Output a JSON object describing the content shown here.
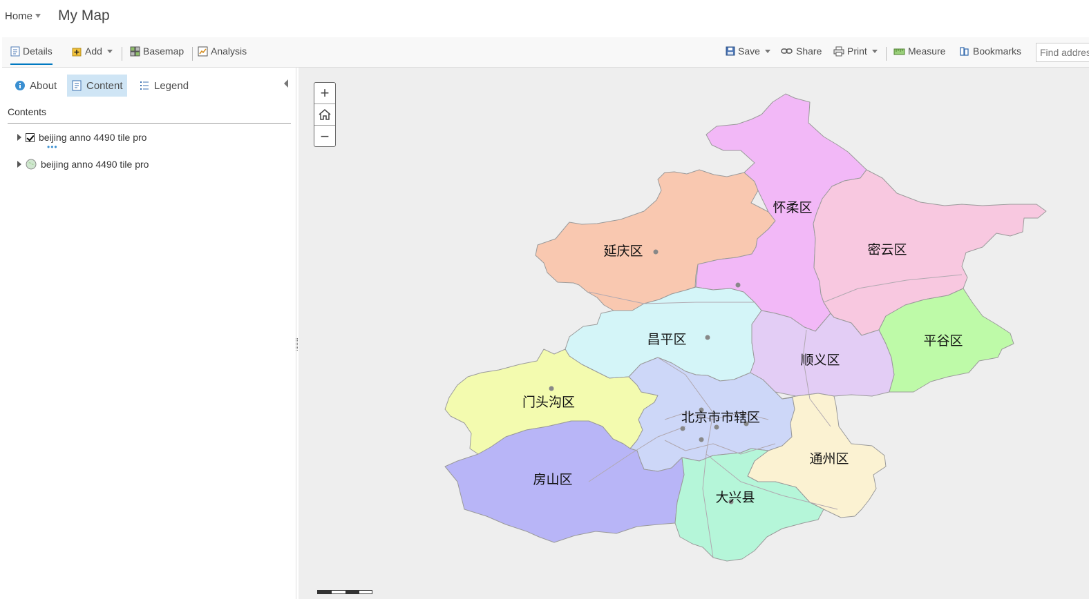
{
  "header": {
    "home_label": "Home",
    "map_title": "My Map"
  },
  "toolbar": {
    "details_label": "Details",
    "add_label": "Add",
    "basemap_label": "Basemap",
    "analysis_label": "Analysis",
    "save_label": "Save",
    "share_label": "Share",
    "print_label": "Print",
    "measure_label": "Measure",
    "bookmarks_label": "Bookmarks",
    "find_placeholder": "Find address or place"
  },
  "panel": {
    "tabs": {
      "about": "About",
      "content": "Content",
      "legend": "Legend"
    },
    "active_tab": "Content",
    "contents_heading": "Contents",
    "layers": [
      {
        "name": "beijing anno 4490 tile pro",
        "checked": true
      },
      {
        "name": "beijing anno 4490 tile pro",
        "checked": false
      }
    ]
  },
  "map": {
    "zoom": {
      "in": "+",
      "out": "−"
    },
    "districts": [
      {
        "name": "延庆区",
        "color": "#f9c8b0"
      },
      {
        "name": "怀柔区",
        "color": "#f2b8f7"
      },
      {
        "name": "密云区",
        "color": "#f8c8e0"
      },
      {
        "name": "昌平区",
        "color": "#d4f5f8"
      },
      {
        "name": "顺义区",
        "color": "#e3cdf5"
      },
      {
        "name": "平谷区",
        "color": "#befaa8"
      },
      {
        "name": "门头沟区",
        "color": "#f3fbaf"
      },
      {
        "name": "北京市市辖区",
        "color": "#cdd7f8"
      },
      {
        "name": "通州区",
        "color": "#fbf2d2"
      },
      {
        "name": "房山区",
        "color": "#b8b5f7"
      },
      {
        "name": "大兴县",
        "color": "#b5f6d9"
      }
    ],
    "colors": {
      "background": "#eeeeee",
      "border": "#9a9a9a",
      "accent": "#0079c1"
    }
  }
}
